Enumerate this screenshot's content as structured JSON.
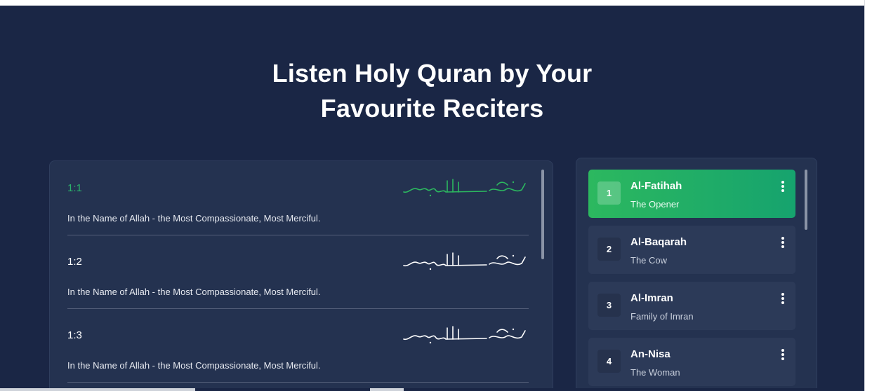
{
  "heading": {
    "line1": "Listen Holy Quran by Your",
    "line2": "Favourite Reciters"
  },
  "verses": [
    {
      "number": "1:1",
      "text": "In the Name of Allah - the Most Compassionate, Most Merciful.",
      "active": true
    },
    {
      "number": "1:2",
      "text": "In the Name of Allah - the Most Compassionate, Most Merciful.",
      "active": false
    },
    {
      "number": "1:3",
      "text": "In the Name of Allah - the Most Compassionate, Most Merciful.",
      "active": false
    }
  ],
  "surahs": [
    {
      "index": "1",
      "name": "Al-Fatihah",
      "translation": "The Opener",
      "active": true
    },
    {
      "index": "2",
      "name": "Al-Baqarah",
      "translation": "The Cow",
      "active": false
    },
    {
      "index": "3",
      "name": "Al-Imran",
      "translation": "Family of Imran",
      "active": false
    },
    {
      "index": "4",
      "name": "An-Nisa",
      "translation": "The Woman",
      "active": false
    }
  ],
  "colors": {
    "background": "#1a2645",
    "panel": "#243250",
    "card": "#2c3a58",
    "accent_green": "#2cb85f",
    "text": "#ffffff"
  },
  "icons": {
    "verse_calligraphy": "bismillah-calligraphy-icon",
    "surah_menu": "more-vertical-icon"
  }
}
